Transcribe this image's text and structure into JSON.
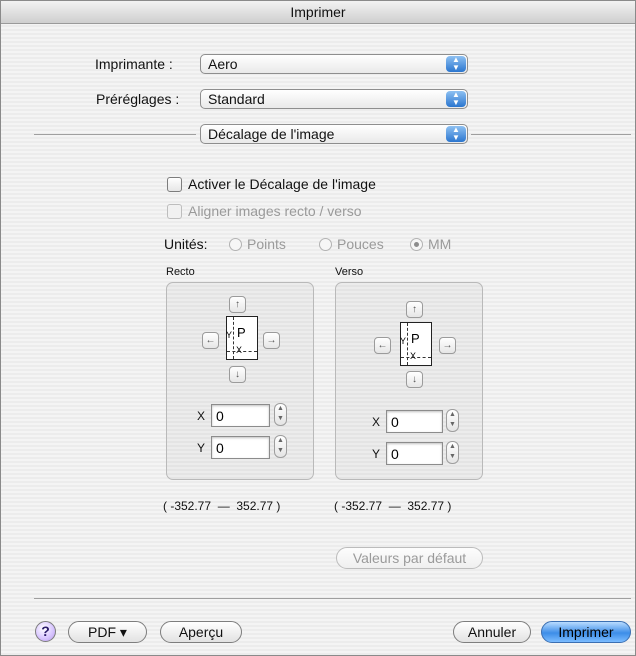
{
  "window": {
    "title": "Imprimer"
  },
  "printer": {
    "label": "Imprimante :",
    "value": "Aero"
  },
  "presets": {
    "label": "Préréglages :",
    "value": "Standard"
  },
  "panel_select": {
    "value": "Décalage de l'image"
  },
  "options": {
    "enable_shift": {
      "label": "Activer le Décalage de l'image",
      "checked": false
    },
    "align_duplex": {
      "label": "Aligner images recto / verso",
      "checked": false,
      "enabled": false
    }
  },
  "units": {
    "label": "Unités:",
    "choices": [
      "Points",
      "Pouces",
      "MM"
    ],
    "selected": "MM"
  },
  "recto": {
    "title": "Recto",
    "page_letter": "P",
    "page_y": "Y",
    "page_x": "X",
    "arrows": {
      "up": "↑",
      "down": "↓",
      "left": "←",
      "right": "→"
    },
    "x_label": "X",
    "x_value": "0",
    "y_label": "Y",
    "y_value": "0",
    "range": "( -352.77  —  352.77 )"
  },
  "verso": {
    "title": "Verso",
    "page_letter": "P",
    "page_y": "Y",
    "page_x": "X",
    "arrows": {
      "up": "↑",
      "down": "↓",
      "left": "←",
      "right": "→"
    },
    "x_label": "X",
    "x_value": "0",
    "y_label": "Y",
    "y_value": "0",
    "range": "( -352.77  —  352.77 )"
  },
  "defaults_button": "Valeurs par défaut",
  "footer": {
    "help": "?",
    "pdf": "PDF ▾",
    "preview": "Aperçu",
    "cancel": "Annuler",
    "print": "Imprimer"
  },
  "colors": {
    "accent": "#3d8de8",
    "disabled_text": "#9a9a9a"
  }
}
